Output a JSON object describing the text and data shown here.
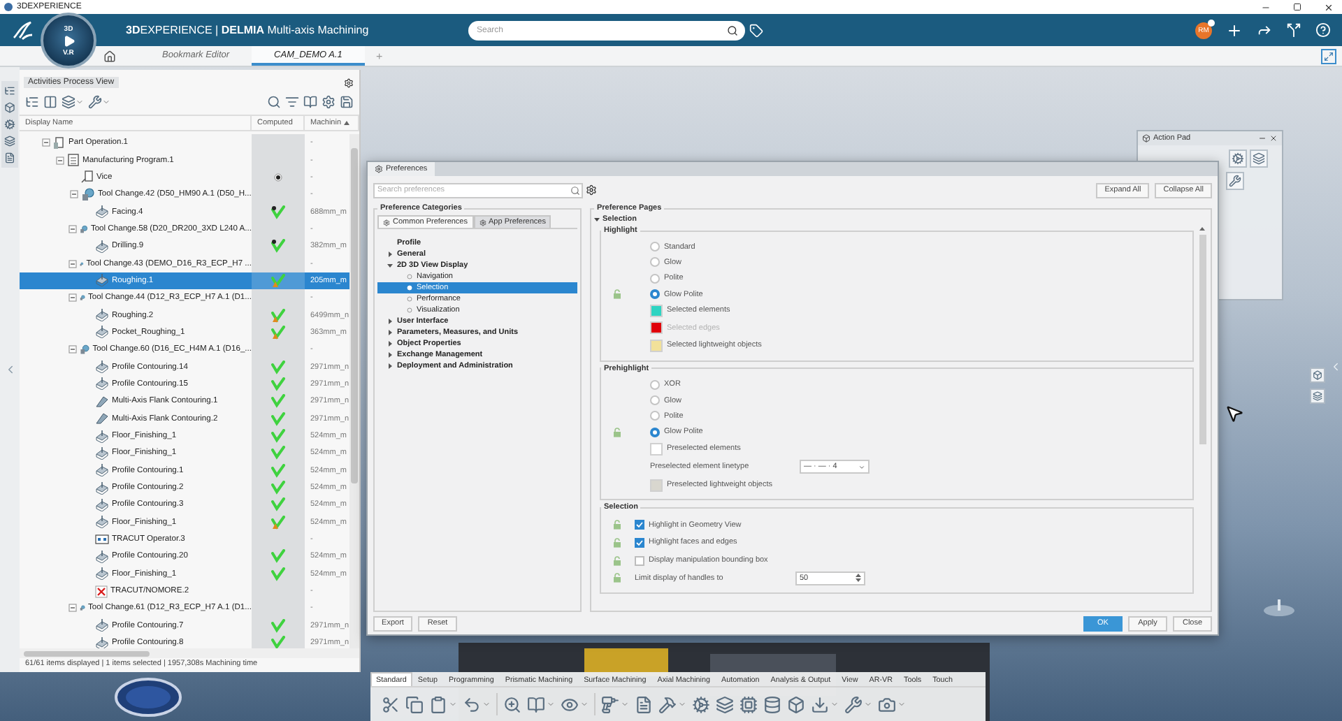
{
  "window": {
    "title": "3DEXPERIENCE"
  },
  "app_bar": {
    "title": "**3D**EXPERIENCE | **DELMIA** Multi-axis Machining",
    "search": {
      "placeholder": "Search"
    },
    "avatar": "RM"
  },
  "compass": {
    "top": "3D",
    "bottom": "V.R"
  },
  "doc_tabs": [
    {
      "label": "Bookmark Editor",
      "selected": false
    },
    {
      "label": "CAM_DEMO A.1",
      "selected": true
    }
  ],
  "new_tab": "+",
  "process_view": {
    "title": "Activities Process View",
    "columns": [
      "Display Name",
      "Computed",
      "Machinin"
    ],
    "tree": [
      {
        "label": "Part Operation.1",
        "kind": "part",
        "marked": false,
        "computed": false,
        "warning": false,
        "machining": "-",
        "selected": false,
        "expanded": true,
        "children": [
          {
            "label": "Manufacturing Program.1",
            "kind": "program",
            "marked": false,
            "computed": false,
            "warning": false,
            "machining": "-",
            "selected": false,
            "expanded": true,
            "children": [
              {
                "label": "Vice",
                "kind": "fixture",
                "marked": true,
                "computed": false,
                "warning": false,
                "machining": "-",
                "selected": false
              },
              {
                "label": "Tool Change.42 (D50_HM90 A.1 (D50_H...",
                "kind": "tool",
                "marked": false,
                "computed": false,
                "warning": false,
                "machining": "-",
                "selected": false,
                "expanded": true,
                "children": [
                  {
                    "label": "Facing.4",
                    "kind": "op",
                    "marked": true,
                    "computed": true,
                    "warning": false,
                    "machining": "688mm_m",
                    "selected": false
                  }
                ]
              },
              {
                "label": "Tool Change.58 (D20_DR200_3XD L240 A...",
                "kind": "tool",
                "marked": false,
                "computed": false,
                "warning": false,
                "machining": "-",
                "selected": false,
                "expanded": true,
                "children": [
                  {
                    "label": "Drilling.9",
                    "kind": "op",
                    "marked": true,
                    "computed": true,
                    "warning": false,
                    "machining": "382mm_m",
                    "selected": false
                  }
                ]
              },
              {
                "label": "Tool Change.43 (DEMO_D16_R3_ECP_H7 ...",
                "kind": "tool",
                "marked": false,
                "computed": false,
                "warning": false,
                "machining": "-",
                "selected": false,
                "expanded": true,
                "children": [
                  {
                    "label": "Roughing.1",
                    "kind": "op",
                    "marked": false,
                    "computed": true,
                    "warning": true,
                    "machining": "205mm_m",
                    "selected": true
                  }
                ]
              },
              {
                "label": "Tool Change.44 (D12_R3_ECP_H7 A.1 (D1...",
                "kind": "tool",
                "marked": false,
                "computed": false,
                "warning": false,
                "machining": "-",
                "selected": false,
                "expanded": true,
                "children": [
                  {
                    "label": "Roughing.2",
                    "kind": "op",
                    "marked": false,
                    "computed": true,
                    "warning": true,
                    "machining": "6499mm_n",
                    "selected": false
                  },
                  {
                    "label": "Pocket_Roughing_1",
                    "kind": "op",
                    "marked": false,
                    "computed": true,
                    "warning": true,
                    "machining": "363mm_m",
                    "selected": false
                  }
                ]
              },
              {
                "label": "Tool Change.60 (D16_EC_H4M A.1 (D16_...",
                "kind": "tool",
                "marked": false,
                "computed": false,
                "warning": false,
                "machining": "-",
                "selected": false,
                "expanded": true,
                "children": [
                  {
                    "label": "Profile Contouring.14",
                    "kind": "op",
                    "marked": false,
                    "computed": true,
                    "warning": false,
                    "machining": "2971mm_n",
                    "selected": false
                  },
                  {
                    "label": "Profile Contouring.15",
                    "kind": "op",
                    "marked": false,
                    "computed": true,
                    "warning": false,
                    "machining": "2971mm_n",
                    "selected": false
                  },
                  {
                    "label": "Multi-Axis Flank Contouring.1",
                    "kind": "flank",
                    "marked": false,
                    "computed": true,
                    "warning": false,
                    "machining": "2971mm_n",
                    "selected": false
                  },
                  {
                    "label": "Multi-Axis Flank Contouring.2",
                    "kind": "flank",
                    "marked": false,
                    "computed": true,
                    "warning": false,
                    "machining": "2971mm_n",
                    "selected": false
                  },
                  {
                    "label": "Floor_Finishing_1",
                    "kind": "op",
                    "marked": false,
                    "computed": true,
                    "warning": false,
                    "machining": "524mm_m",
                    "selected": false
                  },
                  {
                    "label": "Floor_Finishing_1",
                    "kind": "op",
                    "marked": false,
                    "computed": true,
                    "warning": false,
                    "machining": "524mm_m",
                    "selected": false
                  },
                  {
                    "label": "Profile Contouring.1",
                    "kind": "op",
                    "marked": false,
                    "computed": true,
                    "warning": false,
                    "machining": "524mm_m",
                    "selected": false
                  },
                  {
                    "label": "Profile Contouring.2",
                    "kind": "op",
                    "marked": false,
                    "computed": true,
                    "warning": false,
                    "machining": "524mm_m",
                    "selected": false
                  },
                  {
                    "label": "Profile Contouring.3",
                    "kind": "op",
                    "marked": false,
                    "computed": true,
                    "warning": false,
                    "machining": "524mm_m",
                    "selected": false
                  },
                  {
                    "label": "Floor_Finishing_1",
                    "kind": "op",
                    "marked": false,
                    "computed": true,
                    "warning": true,
                    "machining": "524mm_m",
                    "selected": false
                  },
                  {
                    "label": "TRACUT Operator.3",
                    "kind": "machine",
                    "marked": false,
                    "computed": false,
                    "warning": false,
                    "machining": "-",
                    "selected": false
                  },
                  {
                    "label": "Profile Contouring.20",
                    "kind": "op",
                    "marked": false,
                    "computed": true,
                    "warning": false,
                    "machining": "524mm_m",
                    "selected": false
                  },
                  {
                    "label": "Floor_Finishing_1",
                    "kind": "op",
                    "marked": false,
                    "computed": true,
                    "warning": false,
                    "machining": "524mm_m",
                    "selected": false
                  },
                  {
                    "label": "TRACUT/NOMORE.2",
                    "kind": "error",
                    "marked": false,
                    "computed": false,
                    "warning": false,
                    "machining": "-",
                    "selected": false
                  }
                ]
              },
              {
                "label": "Tool Change.61 (D12_R3_ECP_H7 A.1 (D1...",
                "kind": "tool",
                "marked": false,
                "computed": false,
                "warning": false,
                "machining": "-",
                "selected": false,
                "expanded": true,
                "children": [
                  {
                    "label": "Profile Contouring.7",
                    "kind": "op",
                    "marked": false,
                    "computed": true,
                    "warning": false,
                    "machining": "2971mm_n",
                    "selected": false
                  },
                  {
                    "label": "Profile Contouring.8",
                    "kind": "op",
                    "marked": false,
                    "computed": true,
                    "warning": false,
                    "machining": "2971mm_n",
                    "selected": false
                  }
                ]
              }
            ]
          }
        ]
      }
    ],
    "status": "61/61 items displayed | 1 items selected | 1957,308s Machining time"
  },
  "preferences": {
    "title": "Preferences",
    "search": {
      "placeholder": "Search preferences"
    },
    "expand_all": "Expand All",
    "collapse_all": "Collapse All",
    "categories": {
      "legend": "Preference Categories",
      "tabs": [
        {
          "label": "Common Preferences",
          "selected": true
        },
        {
          "label": "App Preferences",
          "selected": false
        }
      ],
      "tree": [
        {
          "label": "Profile",
          "selected": false
        },
        {
          "label": "General",
          "selected": false,
          "expanded": false
        },
        {
          "label": "2D 3D View Display",
          "selected": false,
          "expanded": true,
          "children": [
            {
              "label": "Navigation",
              "selected": false
            },
            {
              "label": "Selection",
              "selected": true
            },
            {
              "label": "Performance",
              "selected": false
            },
            {
              "label": "Visualization",
              "selected": false
            }
          ]
        },
        {
          "label": "User Interface",
          "selected": false,
          "expanded": false
        },
        {
          "label": "Parameters, Measures, and Units",
          "selected": false,
          "expanded": false
        },
        {
          "label": "Object Properties",
          "selected": false,
          "expanded": false
        },
        {
          "label": "Exchange Management",
          "selected": false,
          "expanded": false
        },
        {
          "label": "Deployment and Administration",
          "selected": false,
          "expanded": false
        }
      ]
    },
    "pages": {
      "legend": "Preference Pages",
      "section": {
        "label": "Selection",
        "expanded": true
      },
      "groups": [
        {
          "title": "Highlight",
          "rows": [
            {
              "kind": "radio",
              "label": "Standard",
              "selected": false,
              "locked": false
            },
            {
              "kind": "radio",
              "label": "Glow",
              "selected": false,
              "locked": false
            },
            {
              "kind": "radio",
              "label": "Polite",
              "selected": false,
              "locked": false
            },
            {
              "kind": "radio",
              "label": "Glow Polite",
              "selected": true,
              "locked": true
            },
            {
              "kind": "color",
              "label": "Selected elements",
              "color": "#2fd4c2",
              "disabled": false,
              "locked": false
            },
            {
              "kind": "color",
              "label": "Selected edges",
              "color": "#e0000b",
              "disabled": true,
              "locked": false
            },
            {
              "kind": "color",
              "label": "Selected lightweight objects",
              "color": "#f2e19a",
              "disabled": false,
              "locked": false
            }
          ]
        },
        {
          "title": "Prehighlight",
          "rows": [
            {
              "kind": "radio",
              "label": "XOR",
              "selected": false,
              "locked": false
            },
            {
              "kind": "radio",
              "label": "Glow",
              "selected": false,
              "locked": false
            },
            {
              "kind": "radio",
              "label": "Polite",
              "selected": false,
              "locked": false
            },
            {
              "kind": "radio",
              "label": "Glow Polite",
              "selected": true,
              "locked": true
            },
            {
              "kind": "color",
              "label": "Preselected elements",
              "color": "#ffffff",
              "disabled": false,
              "locked": false
            },
            {
              "kind": "dropdown",
              "label": "Preselected element linetype",
              "value": "— · — · 4",
              "locked": false
            },
            {
              "kind": "color",
              "label": "Preselected lightweight objects",
              "color": "#d9d7cf",
              "disabled": false,
              "locked": false
            }
          ]
        },
        {
          "title": "Selection",
          "rows": [
            {
              "kind": "checkbox",
              "label": "Highlight in Geometry View",
              "checked": true,
              "locked": true
            },
            {
              "kind": "checkbox",
              "label": "Highlight faces and edges",
              "checked": true,
              "locked": true
            },
            {
              "kind": "checkbox",
              "label": "Display manipulation bounding box",
              "checked": false,
              "locked": true
            },
            {
              "kind": "spinner",
              "label": "Limit display of handles to",
              "value": "50",
              "locked": true
            }
          ]
        }
      ]
    },
    "footer_left": [
      "Export",
      "Reset"
    ],
    "footer_right": [
      {
        "label": "OK",
        "primary": true
      },
      {
        "label": "Apply",
        "primary": false
      },
      {
        "label": "Close",
        "primary": false
      }
    ]
  },
  "action_pad": {
    "title": "Action Pad"
  },
  "toolbar": {
    "tabs": [
      {
        "label": "Standard",
        "selected": true
      },
      {
        "label": "Setup",
        "selected": false
      },
      {
        "label": "Programming",
        "selected": false
      },
      {
        "label": "Prismatic Machining",
        "selected": false
      },
      {
        "label": "Surface Machining",
        "selected": false
      },
      {
        "label": "Axial Machining",
        "selected": false
      },
      {
        "label": "Automation",
        "selected": false
      },
      {
        "label": "Analysis & Output",
        "selected": false
      },
      {
        "label": "View",
        "selected": false
      },
      {
        "label": "AR-VR",
        "selected": false
      },
      {
        "label": "Tools",
        "selected": false
      },
      {
        "label": "Touch",
        "selected": false
      }
    ]
  }
}
